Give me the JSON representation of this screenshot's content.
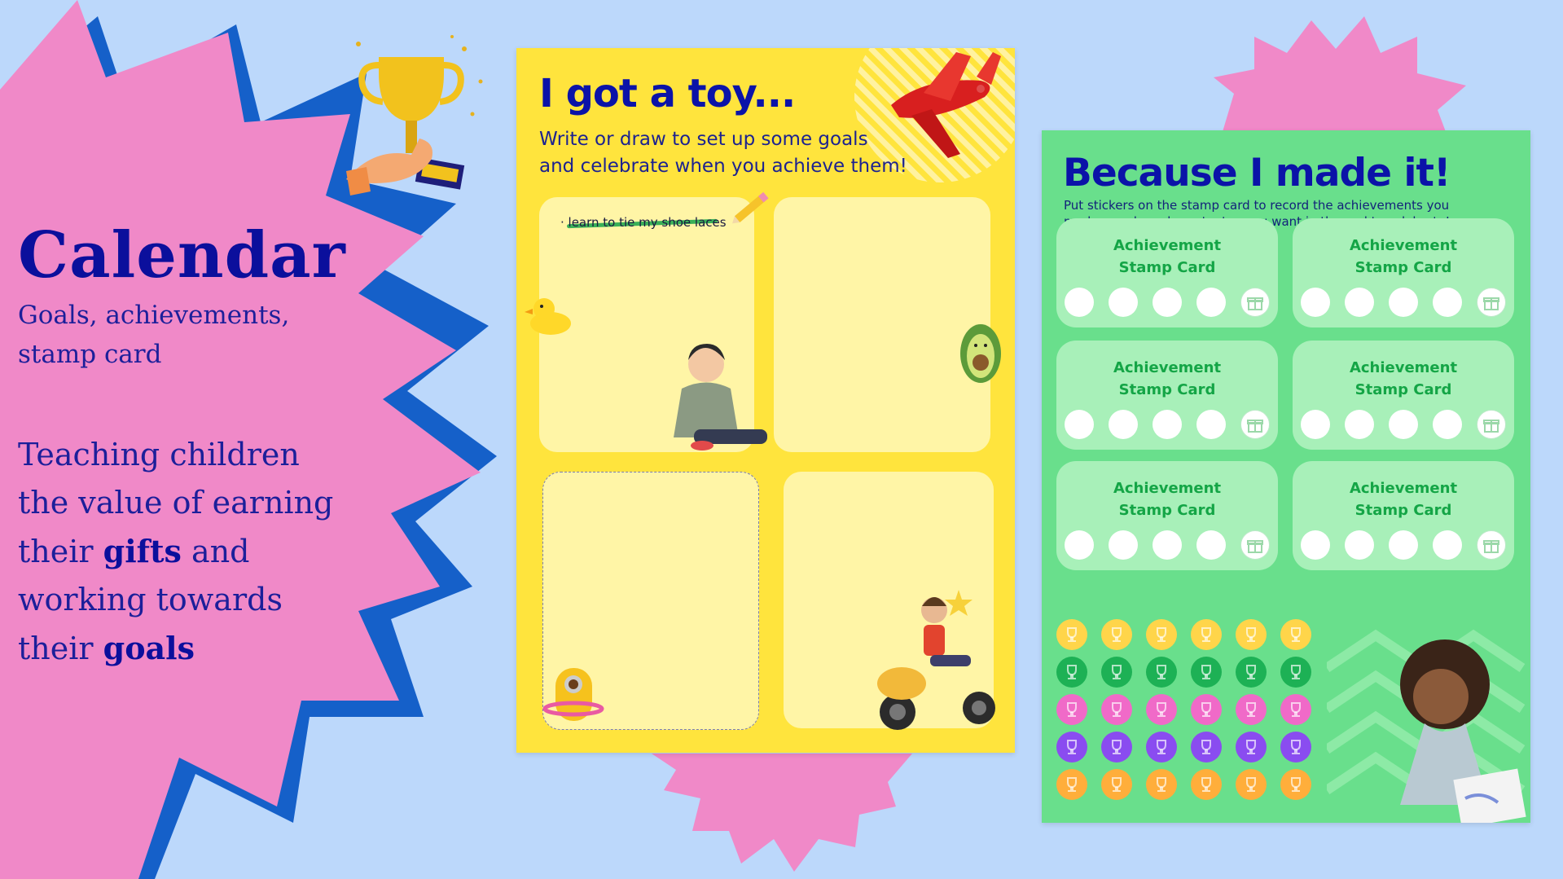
{
  "left": {
    "title": "Calendar",
    "subtitle_line1": "Goals, achievements,",
    "subtitle_line2": "stamp card",
    "body_l1": "Teaching children",
    "body_l2": "the value of earning",
    "body_l3a": "their ",
    "body_l3b": "gifts",
    "body_l3c": " and",
    "body_l4": "working towards",
    "body_l5a": "their ",
    "body_l5b": "goals"
  },
  "poster_yellow": {
    "title": "I got a toy...",
    "subtitle_line1": "Write or draw to set up some goals",
    "subtitle_line2": "and celebrate when you achieve them!",
    "goal_note": "· learn to tie my shoe laces"
  },
  "poster_green": {
    "title": "Because I made it!",
    "subtitle_line1": "Put stickers on the stamp card to record the achievements you",
    "subtitle_line2": "made... and maybe get a toy you want in the end to celebrate!",
    "card_line1": "Achievement",
    "card_line2": "Stamp Card",
    "sticker_colors": [
      "#ffd54a",
      "#1db155",
      "#f06ac8",
      "#8a4cf0",
      "#ffae3b"
    ]
  },
  "colors": {
    "background": "#bcd8fb",
    "burst_pink": "#f089c8",
    "burst_blue": "#1560c9",
    "navy": "#0b0f9c",
    "yellow_poster": "#ffe43d",
    "green_poster": "#69df8c"
  },
  "icons": [
    "trophy-icon",
    "toy-plane-icon",
    "pencil-icon",
    "rubber-duck-icon",
    "avocado-plush-icon",
    "gift-icon",
    "trophy-sticker-icon"
  ]
}
